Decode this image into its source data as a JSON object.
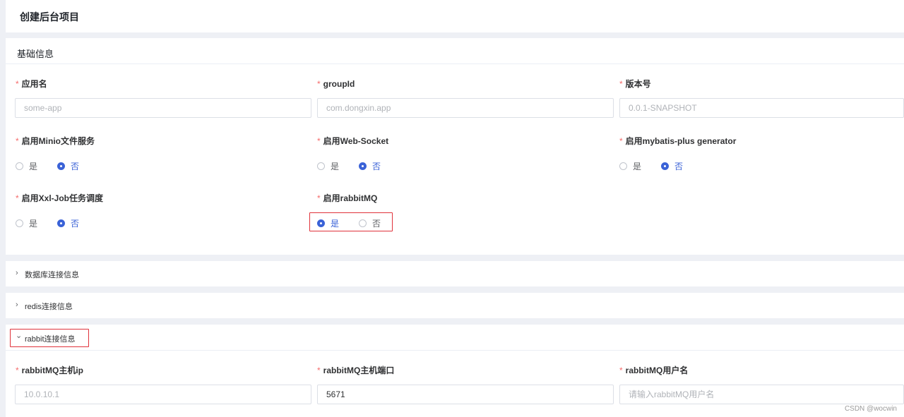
{
  "page": {
    "title": "创建后台项目"
  },
  "basic": {
    "header": "基础信息",
    "fields": {
      "app_name": {
        "label": "应用名",
        "placeholder": "some-app"
      },
      "group_id": {
        "label": "groupId",
        "placeholder": "com.dongxin.app"
      },
      "version": {
        "label": "版本号",
        "placeholder": "0.0.1-SNAPSHOT"
      }
    },
    "radios": {
      "minio": {
        "label": "启用Minio文件服务",
        "yes": "是",
        "no": "否",
        "selected": "no"
      },
      "websocket": {
        "label": "启用Web-Socket",
        "yes": "是",
        "no": "否",
        "selected": "no"
      },
      "mybatis": {
        "label": "启用mybatis-plus generator",
        "yes": "是",
        "no": "否",
        "selected": "no"
      },
      "xxljob": {
        "label": "启用Xxl-Job任务调度",
        "yes": "是",
        "no": "否",
        "selected": "no"
      },
      "rabbitmq": {
        "label": "启用rabbitMQ",
        "yes": "是",
        "no": "否",
        "selected": "yes"
      }
    }
  },
  "collapses": {
    "db": {
      "title": "数据库连接信息",
      "arrow": "›"
    },
    "redis": {
      "title": "redis连接信息",
      "arrow": "›"
    },
    "rabbit": {
      "title": "rabbit连接信息",
      "arrow": "⌄"
    }
  },
  "rabbit": {
    "host": {
      "label": "rabbitMQ主机ip",
      "placeholder": "10.0.10.1"
    },
    "port": {
      "label": "rabbitMQ主机端口",
      "value": "5671"
    },
    "username": {
      "label": "rabbitMQ用户名",
      "placeholder": "请输入rabbitMQ用户名"
    }
  },
  "required_mark": "*",
  "watermark": "CSDN @wocwin",
  "colors": {
    "primary": "#3a62d7",
    "required": "#f56c6c",
    "highlight": "#e0323a"
  }
}
